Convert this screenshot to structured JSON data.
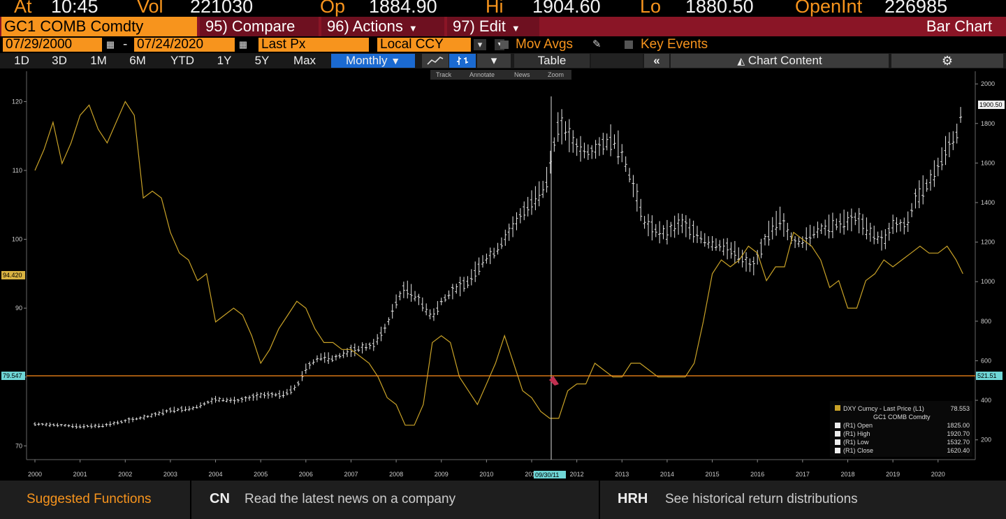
{
  "quote": {
    "at_label": "At",
    "at_value": "10:45",
    "vol_label": "Vol",
    "vol_value": "221030",
    "op_label": "Op",
    "op_value": "1884.90",
    "hi_label": "Hi",
    "hi_value": "1904.60",
    "lo_label": "Lo",
    "lo_value": "1880.50",
    "oi_label": "OpenInt",
    "oi_value": "226985"
  },
  "toolbar": {
    "ticker": "GC1 COMB Comdty",
    "compare": "95) Compare",
    "actions": "96) Actions",
    "edit": "97) Edit",
    "chart_type": "Bar Chart"
  },
  "settings": {
    "start_date": "07/29/2000",
    "dash": "-",
    "end_date": "07/24/2020",
    "field": "Last Px",
    "currency": "Local CCY",
    "mov_avgs": "Mov Avgs",
    "key_events": "Key Events"
  },
  "periods": [
    "1D",
    "3D",
    "1M",
    "6M",
    "YTD",
    "1Y",
    "5Y",
    "Max"
  ],
  "frequency": "Monthly",
  "table_label": "Table",
  "collapse_label": "«",
  "chart_content_label": "Chart Content",
  "chart_tools": [
    "Track",
    "Annotate",
    "News",
    "Zoom"
  ],
  "colors": {
    "accent": "#f7941d",
    "header_bar": "#8a1526",
    "dxy_line": "#c9a227",
    "selected": "#1b6ad1",
    "crosshair": "#ff8c1a"
  },
  "chart_data": {
    "type": "line",
    "x_labels": [
      "2000",
      "2001",
      "2002",
      "2003",
      "2004",
      "2005",
      "2006",
      "2007",
      "2008",
      "2009",
      "2010",
      "2011",
      "2012",
      "2013",
      "2014",
      "2015",
      "2016",
      "2017",
      "2018",
      "2019",
      "2020"
    ],
    "left_axis": {
      "ticks": [
        70,
        80,
        90,
        100,
        110,
        120
      ],
      "min": 68,
      "max": 124
    },
    "right_axis": {
      "ticks": [
        200,
        400,
        600,
        800,
        1000,
        1200,
        1400,
        1600,
        1800,
        2000
      ],
      "min": 100,
      "max": 2050
    },
    "left_badge": "94.420",
    "crosshair_left_label": "79.547",
    "crosshair_right_label": "521.51",
    "crosshair_date": "09/30/11",
    "last_price_right_label": "1900.50",
    "series": [
      {
        "name": "DXY Curncy - Last Price (L1)",
        "axis": "left",
        "color": "#c9a227",
        "points": [
          [
            2000.0,
            110
          ],
          [
            2000.2,
            113
          ],
          [
            2000.4,
            117
          ],
          [
            2000.6,
            111
          ],
          [
            2000.8,
            114
          ],
          [
            2001.0,
            118
          ],
          [
            2001.2,
            119.5
          ],
          [
            2001.4,
            116
          ],
          [
            2001.6,
            114
          ],
          [
            2001.8,
            117
          ],
          [
            2002.0,
            120
          ],
          [
            2002.2,
            118
          ],
          [
            2002.4,
            106
          ],
          [
            2002.6,
            107
          ],
          [
            2002.8,
            106
          ],
          [
            2003.0,
            101
          ],
          [
            2003.2,
            98
          ],
          [
            2003.4,
            97
          ],
          [
            2003.6,
            94
          ],
          [
            2003.8,
            95
          ],
          [
            2004.0,
            88
          ],
          [
            2004.2,
            89
          ],
          [
            2004.4,
            90
          ],
          [
            2004.6,
            89
          ],
          [
            2004.8,
            86
          ],
          [
            2005.0,
            82
          ],
          [
            2005.2,
            84
          ],
          [
            2005.4,
            87
          ],
          [
            2005.6,
            89
          ],
          [
            2005.8,
            91
          ],
          [
            2006.0,
            90
          ],
          [
            2006.2,
            87
          ],
          [
            2006.4,
            85
          ],
          [
            2006.6,
            85
          ],
          [
            2006.8,
            84
          ],
          [
            2007.0,
            84
          ],
          [
            2007.2,
            83
          ],
          [
            2007.4,
            82
          ],
          [
            2007.6,
            80
          ],
          [
            2007.8,
            77
          ],
          [
            2008.0,
            76
          ],
          [
            2008.2,
            73
          ],
          [
            2008.4,
            73
          ],
          [
            2008.6,
            76
          ],
          [
            2008.8,
            85
          ],
          [
            2009.0,
            86
          ],
          [
            2009.2,
            85
          ],
          [
            2009.4,
            80
          ],
          [
            2009.6,
            78
          ],
          [
            2009.8,
            76
          ],
          [
            2010.0,
            79
          ],
          [
            2010.2,
            82
          ],
          [
            2010.4,
            86
          ],
          [
            2010.6,
            82
          ],
          [
            2010.8,
            78
          ],
          [
            2011.0,
            77
          ],
          [
            2011.2,
            75
          ],
          [
            2011.4,
            74
          ],
          [
            2011.6,
            74
          ],
          [
            2011.8,
            78
          ],
          [
            2012.0,
            79
          ],
          [
            2012.2,
            79
          ],
          [
            2012.4,
            82
          ],
          [
            2012.6,
            81
          ],
          [
            2012.8,
            80
          ],
          [
            2013.0,
            80
          ],
          [
            2013.2,
            82
          ],
          [
            2013.4,
            82
          ],
          [
            2013.6,
            81
          ],
          [
            2013.8,
            80
          ],
          [
            2014.0,
            80
          ],
          [
            2014.2,
            80
          ],
          [
            2014.4,
            80
          ],
          [
            2014.6,
            82
          ],
          [
            2014.8,
            88
          ],
          [
            2015.0,
            95
          ],
          [
            2015.2,
            97
          ],
          [
            2015.4,
            96
          ],
          [
            2015.6,
            97
          ],
          [
            2015.8,
            99
          ],
          [
            2016.0,
            98
          ],
          [
            2016.2,
            94
          ],
          [
            2016.4,
            96
          ],
          [
            2016.6,
            96
          ],
          [
            2016.8,
            101
          ],
          [
            2017.0,
            100
          ],
          [
            2017.2,
            99
          ],
          [
            2017.4,
            97
          ],
          [
            2017.6,
            93
          ],
          [
            2017.8,
            94
          ],
          [
            2018.0,
            90
          ],
          [
            2018.2,
            90
          ],
          [
            2018.4,
            94
          ],
          [
            2018.6,
            95
          ],
          [
            2018.8,
            97
          ],
          [
            2019.0,
            96
          ],
          [
            2019.2,
            97
          ],
          [
            2019.4,
            98
          ],
          [
            2019.6,
            99
          ],
          [
            2019.8,
            98
          ],
          [
            2020.0,
            98
          ],
          [
            2020.2,
            99
          ],
          [
            2020.4,
            97
          ],
          [
            2020.55,
            95
          ]
        ]
      },
      {
        "name": "GC1 COMB Comdty (R1 Close)",
        "axis": "right",
        "color": "#e8e8e8",
        "points": [
          [
            2000.0,
            280
          ],
          [
            2000.5,
            275
          ],
          [
            2001.0,
            268
          ],
          [
            2001.5,
            272
          ],
          [
            2002.0,
            295
          ],
          [
            2002.5,
            318
          ],
          [
            2003.0,
            350
          ],
          [
            2003.5,
            360
          ],
          [
            2004.0,
            405
          ],
          [
            2004.5,
            398
          ],
          [
            2005.0,
            425
          ],
          [
            2005.5,
            430
          ],
          [
            2005.8,
            470
          ],
          [
            2006.0,
            560
          ],
          [
            2006.3,
            620
          ],
          [
            2006.6,
            610
          ],
          [
            2007.0,
            650
          ],
          [
            2007.5,
            680
          ],
          [
            2007.8,
            780
          ],
          [
            2008.0,
            900
          ],
          [
            2008.2,
            970
          ],
          [
            2008.5,
            910
          ],
          [
            2008.8,
            820
          ],
          [
            2009.0,
            900
          ],
          [
            2009.3,
            960
          ],
          [
            2009.6,
            1000
          ],
          [
            2009.9,
            1100
          ],
          [
            2010.2,
            1150
          ],
          [
            2010.5,
            1250
          ],
          [
            2010.8,
            1350
          ],
          [
            2011.0,
            1400
          ],
          [
            2011.3,
            1480
          ],
          [
            2011.6,
            1800
          ],
          [
            2011.8,
            1750
          ],
          [
            2012.0,
            1680
          ],
          [
            2012.3,
            1650
          ],
          [
            2012.6,
            1700
          ],
          [
            2012.8,
            1720
          ],
          [
            2013.0,
            1650
          ],
          [
            2013.3,
            1450
          ],
          [
            2013.5,
            1300
          ],
          [
            2013.8,
            1250
          ],
          [
            2014.0,
            1250
          ],
          [
            2014.3,
            1300
          ],
          [
            2014.6,
            1250
          ],
          [
            2014.9,
            1200
          ],
          [
            2015.2,
            1180
          ],
          [
            2015.5,
            1150
          ],
          [
            2015.9,
            1070
          ],
          [
            2016.2,
            1230
          ],
          [
            2016.5,
            1320
          ],
          [
            2016.8,
            1200
          ],
          [
            2017.0,
            1200
          ],
          [
            2017.3,
            1260
          ],
          [
            2017.6,
            1280
          ],
          [
            2017.9,
            1300
          ],
          [
            2018.2,
            1320
          ],
          [
            2018.5,
            1250
          ],
          [
            2018.8,
            1200
          ],
          [
            2019.0,
            1290
          ],
          [
            2019.3,
            1280
          ],
          [
            2019.5,
            1420
          ],
          [
            2019.8,
            1500
          ],
          [
            2020.0,
            1580
          ],
          [
            2020.2,
            1680
          ],
          [
            2020.4,
            1730
          ],
          [
            2020.55,
            1900
          ]
        ]
      }
    ],
    "legend": {
      "title": "DXY Curncy - Last Price (L1)",
      "title_value": "78.553",
      "subtitle": "GC1 COMB Comdty",
      "items": [
        {
          "label": "(R1) Open",
          "value": "1825.00"
        },
        {
          "label": "(R1) High",
          "value": "1920.70"
        },
        {
          "label": "(R1) Low",
          "value": "1532.70"
        },
        {
          "label": "(R1) Close",
          "value": "1620.40"
        }
      ]
    }
  },
  "bottom": {
    "suggested": "Suggested Functions",
    "fn1_code": "CN",
    "fn1_desc": "Read the latest news on a company",
    "fn2_code": "HRH",
    "fn2_desc": "See historical return distributions"
  }
}
